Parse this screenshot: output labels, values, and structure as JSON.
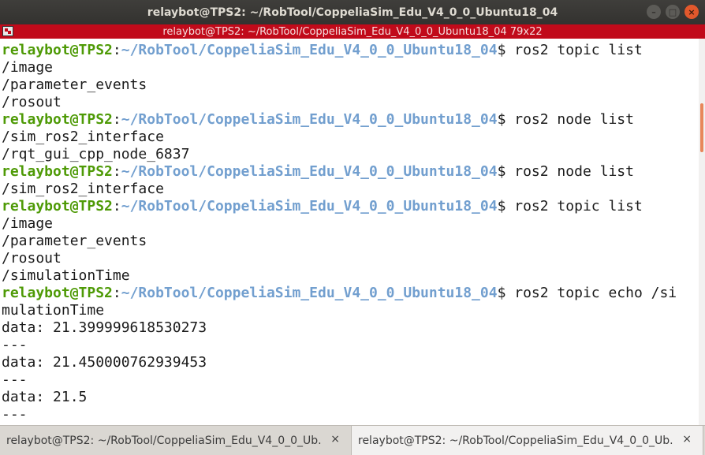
{
  "window": {
    "title": "relaybot@TPS2: ~/RobTool/CoppeliaSim_Edu_V4_0_0_Ubuntu18_04",
    "controls": [
      "–",
      "□",
      "×"
    ]
  },
  "inner_title": "relaybot@TPS2: ~/RobTool/CoppeliaSim_Edu_V4_0_0_Ubuntu18_04 79x22",
  "prompt": {
    "user_host": "relaybot@TPS2",
    "separator": ":",
    "path": "~/RobTool/CoppeliaSim_Edu_V4_0_0_Ubuntu18_04",
    "symbol": "$"
  },
  "commands": {
    "c1": " ros2 topic list",
    "c2": " ros2 node list",
    "c3": " ros2 node list",
    "c4": " ros2 topic list",
    "c5": " ros2 topic echo /si"
  },
  "output": {
    "o1": "/image",
    "o2": "/parameter_events",
    "o3": "/rosout",
    "o4": "/sim_ros2_interface",
    "o5": "/rqt_gui_cpp_node_6837",
    "o6": "/sim_ros2_interface",
    "o7": "/image",
    "o8": "/parameter_events",
    "o9": "/rosout",
    "o10": "/simulationTime",
    "o11": "mulationTime",
    "o12": "data: 21.399999618530273",
    "o13": "---",
    "o14": "data: 21.450000762939453",
    "o15": "---",
    "o16": "data: 21.5",
    "o17": "---"
  },
  "tabs": [
    {
      "label": "relaybot@TPS2: ~/RobTool/CoppeliaSim_Edu_V4_0_0_Ub...",
      "close": "×"
    },
    {
      "label": "relaybot@TPS2: ~/RobTool/CoppeliaSim_Edu_V4_0_0_Ub...",
      "close": "×"
    }
  ],
  "colors": {
    "prompt_user": "#4e9a06",
    "prompt_path": "#729fcf",
    "inner_bar": "#c10a1a",
    "scroll_thumb": "#e8875a"
  }
}
